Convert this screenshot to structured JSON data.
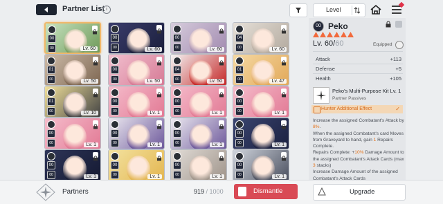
{
  "header": {
    "title": "Partner List",
    "sort_label": "Level",
    "icons": [
      "back-arrow-icon",
      "info-icon",
      "filter-icon",
      "sort-order-icon",
      "home-icon",
      "menu-icon"
    ]
  },
  "grid": {
    "cards": [
      {
        "type": "00",
        "level_text": "Lv. 60",
        "locked": true,
        "selected": true,
        "palette": [
          "#c7e3c0",
          "#6f9a5a"
        ]
      },
      {
        "type": "00",
        "level_text": "Lv. 60",
        "locked": true,
        "selected": false,
        "palette": [
          "#3a3d6c",
          "#1b1f3c"
        ]
      },
      {
        "type": "00",
        "level_text": "Lv. 60",
        "locked": true,
        "selected": false,
        "palette": [
          "#d6ccdc",
          "#a28bb0"
        ]
      },
      {
        "type": "04",
        "level_text": "Lv. 60",
        "locked": true,
        "selected": false,
        "palette": [
          "#e6e0d8",
          "#b3aa9f"
        ]
      },
      {
        "type": "01",
        "level_text": "Lv. 50",
        "locked": true,
        "selected": false,
        "palette": [
          "#cdbba8",
          "#7e6752"
        ]
      },
      {
        "type": "00",
        "level_text": "Lv. 50",
        "locked": true,
        "selected": false,
        "palette": [
          "#f2c0cf",
          "#d67b96"
        ]
      },
      {
        "type": "04",
        "level_text": "Lv. 50",
        "locked": true,
        "selected": false,
        "palette": [
          "#f3f3f3",
          "#c52a2a"
        ]
      },
      {
        "type": "01",
        "level_text": "Lv. 47",
        "locked": true,
        "selected": false,
        "palette": [
          "#f5d9a3",
          "#e2a95a"
        ]
      },
      {
        "type": "01",
        "level_text": "Lv. 10",
        "locked": true,
        "selected": false,
        "palette": [
          "#f1e09a",
          "#444"
        ]
      },
      {
        "type": "00",
        "level_text": "Lv. 1",
        "locked": true,
        "selected": false,
        "palette": [
          "#f5bccb",
          "#e27a95"
        ]
      },
      {
        "type": "00",
        "level_text": "Lv. 1",
        "locked": true,
        "selected": false,
        "palette": [
          "#f5bccb",
          "#e27a95"
        ]
      },
      {
        "type": "00",
        "level_text": "Lv. 1",
        "locked": true,
        "selected": false,
        "palette": [
          "#f5bccb",
          "#e27a95"
        ]
      },
      {
        "type": "00",
        "level_text": "Lv. 1",
        "locked": true,
        "selected": false,
        "palette": [
          "#f5bccb",
          "#e27a95"
        ]
      },
      {
        "type": "00",
        "level_text": "Lv. 1",
        "locked": true,
        "selected": false,
        "palette": [
          "#ece9f0",
          "#6e5a9c"
        ]
      },
      {
        "type": "00",
        "level_text": "Lv. 1",
        "locked": true,
        "selected": false,
        "palette": [
          "#ece9f0",
          "#6e5a9c"
        ]
      },
      {
        "type": "00",
        "level_text": "Lv. 1",
        "locked": true,
        "selected": false,
        "palette": [
          "#3a4570",
          "#1b2040"
        ]
      },
      {
        "type": "00",
        "level_text": "Lv. 1",
        "locked": true,
        "selected": false,
        "palette": [
          "#2e3558",
          "#151a33"
        ]
      },
      {
        "type": "00",
        "level_text": "Lv. 1",
        "locked": true,
        "selected": false,
        "palette": [
          "#f3e2a0",
          "#e3b650"
        ]
      },
      {
        "type": "00",
        "level_text": "Lv. 1",
        "locked": true,
        "selected": false,
        "palette": [
          "#e2ddd8",
          "#9f948a"
        ]
      },
      {
        "type": "00",
        "level_text": "Lv. 1",
        "locked": true,
        "selected": false,
        "palette": [
          "#cfd4dc",
          "#4b5060"
        ]
      }
    ]
  },
  "detail": {
    "name": "Peko",
    "type_badge": "00",
    "star_count": 6,
    "level_current": "Lv. 60/",
    "level_max": "60",
    "equipped_label": "Equipped",
    "stats": [
      {
        "label": "Attack",
        "value": "+113"
      },
      {
        "label": "Defense",
        "value": "+5"
      },
      {
        "label": "Health",
        "value": "+105"
      }
    ],
    "kit_title": "Peko's Multi-Purpose Kit Lv. 1",
    "kit_subtitle": "Partner Passives",
    "effect_label": "Hunter Additional Effect",
    "description": [
      [
        "Increase the assigned Combatant's Attack by ",
        "8%",
        "."
      ],
      [
        "When the assigned Combatant's card Moves from Graveyard to hand, gain ",
        "1",
        " Repairs Complete."
      ],
      [
        "Repairs Complete: +",
        "10%",
        " Damage Amount to the assigned Combatant's Attack Cards (max ",
        "3",
        " stacks)"
      ],
      [
        "Increase Damage Amount of the assigned Combatant's Attack Cards",
        "",
        ""
      ]
    ]
  },
  "footer": {
    "partners_label": "Partners",
    "count_current": "919",
    "count_max": "/ 1000",
    "dismantle_label": "Dismantle",
    "upgrade_label": "Upgrade"
  },
  "colors": {
    "accent_orange": "#e47219",
    "dismantle_red": "#d94a55",
    "star_orange": "#f26a3c",
    "dark_button": "#1d2430"
  }
}
